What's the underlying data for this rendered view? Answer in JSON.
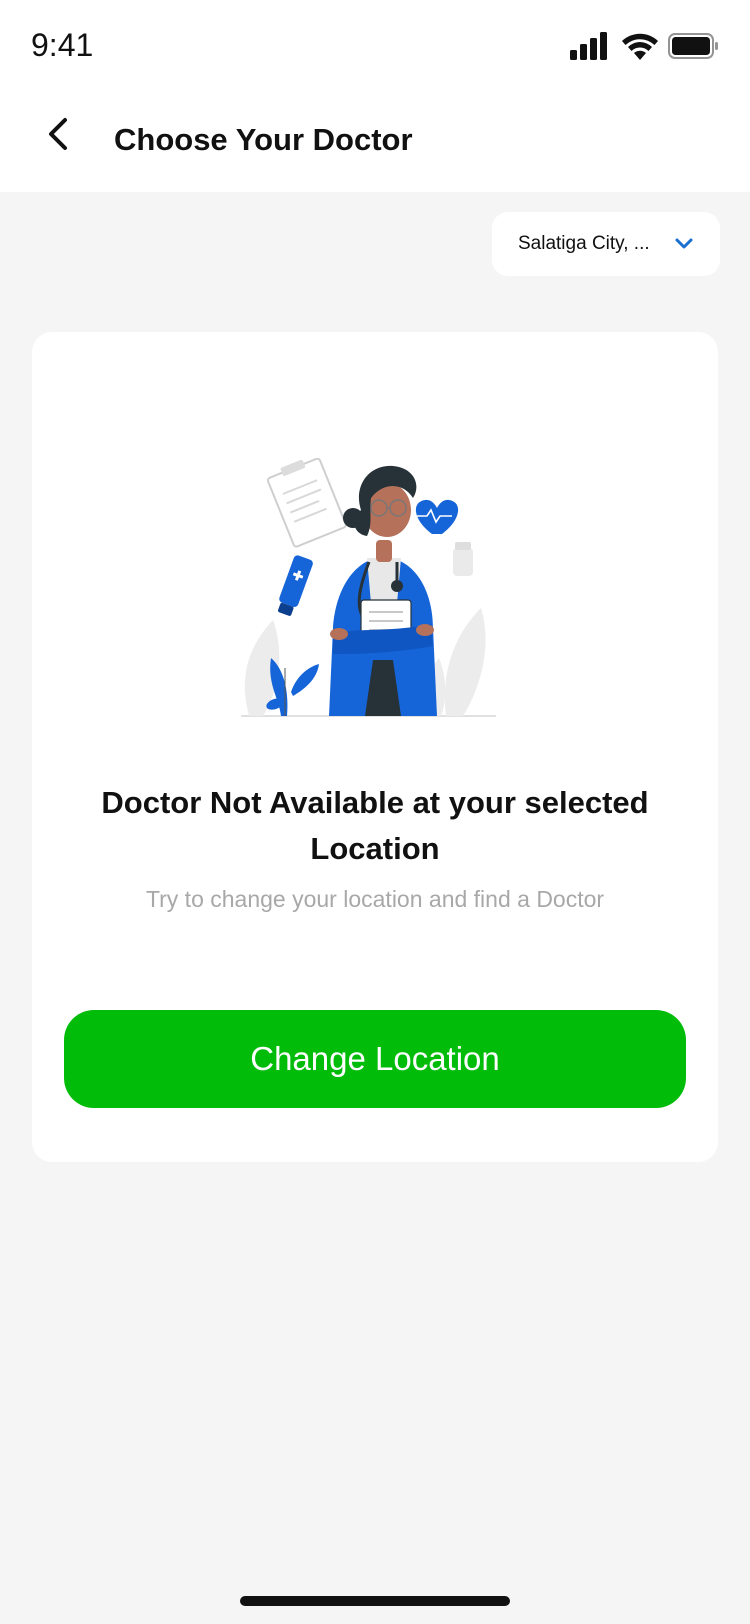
{
  "status_bar": {
    "time": "9:41"
  },
  "header": {
    "title": "Choose Your Doctor",
    "back_icon": "chevron-left-icon"
  },
  "location_select": {
    "value": "Salatiga City, ...",
    "icon": "chevron-down-icon"
  },
  "empty_state": {
    "illustration": "doctor-illustration",
    "title": "Doctor Not Available at your selected Location",
    "subtitle": "Try to change your location and find a Doctor",
    "button_label": "Change Location"
  },
  "colors": {
    "accent": "#02bc0a",
    "illustration_blue": "#1565d8",
    "chevron_blue": "#1a6fd1",
    "background": "#f5f5f5",
    "muted_text": "#a8a8a8"
  }
}
